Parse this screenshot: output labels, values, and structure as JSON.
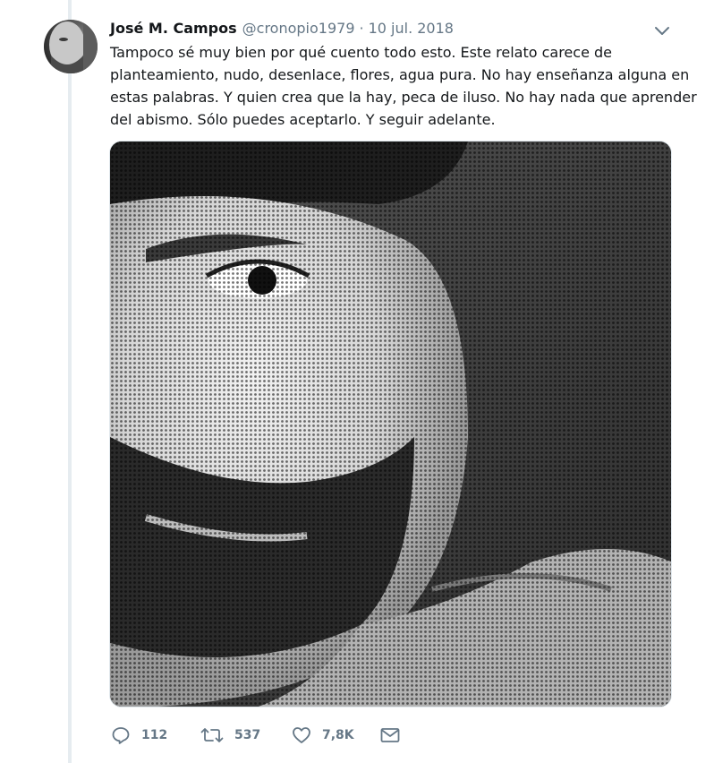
{
  "tweet": {
    "author": {
      "fullname": "José M. Campos",
      "handle": "@cronopio1979",
      "avatar_icon": "profile-photo"
    },
    "separator": "·",
    "timestamp": "10 jul. 2018",
    "text_lines": [
      "Tampoco sé muy bien por qué cuento todo esto. Este relato carece de",
      "planteamiento, nudo, desenlace, flores, agua pura. No hay enseñanza alguna en",
      "estas palabras. Y quien crea que la hay, peca de iluso. No hay nada que aprender",
      "del abismo. Sólo puedes aceptarlo. Y seguir adelante."
    ],
    "media": {
      "description_icon": "halftone-portrait-photo"
    },
    "actions": {
      "reply": {
        "icon": "reply-icon",
        "count": "112"
      },
      "retweet": {
        "icon": "retweet-icon",
        "count": "537"
      },
      "like": {
        "icon": "heart-icon",
        "count": "7,8K"
      },
      "message": {
        "icon": "direct-message-icon"
      }
    }
  },
  "colors": {
    "text": "#14171a",
    "secondary": "#657786",
    "thread_line": "#e6ecf0",
    "border": "#e1e8ed"
  }
}
